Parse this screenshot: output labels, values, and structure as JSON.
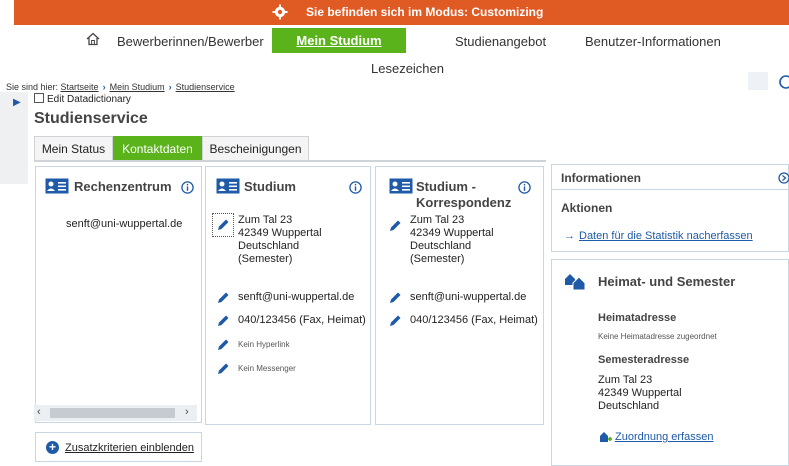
{
  "banner": {
    "text": "Sie befinden sich im Modus: Customizing",
    "icon": "gear-icon"
  },
  "topnav": {
    "items": [
      "Bewerberinnen/Bewerber",
      "Mein Studium",
      "Studienangebot",
      "Benutzer-Informationen"
    ],
    "active_index": 1,
    "bookmark": "Lesezeichen"
  },
  "breadcrumb": {
    "prefix": "Sie sind hier:",
    "items": [
      "Startseite",
      "Mein Studium",
      "Studienservice"
    ]
  },
  "edit_dd": "Edit Datadictionary",
  "page_title": "Studienservice",
  "tabs": [
    "Mein Status",
    "Kontaktdaten",
    "Bescheinigungen"
  ],
  "active_tab": 1,
  "cards": {
    "rechenzentrum": {
      "title": "Rechenzentrum",
      "email": "senft@uni-wuppertal.de"
    },
    "studium": {
      "title": "Studium",
      "address": [
        "Zum Tal 23",
        "42349 Wuppertal",
        "Deutschland",
        "(Semester)"
      ],
      "email": "senft@uni-wuppertal.de",
      "phone": "040/123456 (Fax, Heimat)",
      "hyperlink": "Kein Hyperlink",
      "messenger": "Kein Messenger"
    },
    "korrespondenz": {
      "title_line1": "Studium -",
      "title_line2": "Korrespondenz",
      "address": [
        "Zum Tal 23",
        "42349 Wuppertal",
        "Deutschland",
        "(Semester)"
      ],
      "email": "senft@uni-wuppertal.de",
      "phone": "040/123456 (Fax, Heimat)"
    }
  },
  "zusatz": "Zusatzkriterien einblenden",
  "right": {
    "informationen": "Informationen",
    "aktionen": "Aktionen",
    "aktion_link": "Daten für die Statistik nacherfassen",
    "heimat_title": "Heimat- und Semester",
    "heimatadresse_label": "Heimatadresse",
    "heimatadresse_none": "Keine Heimatadresse zugeordnet",
    "semesteradresse_label": "Semesteradresse",
    "semesteradresse": [
      "Zum Tal 23",
      "42349 Wuppertal",
      "Deutschland"
    ],
    "zuordnung": "Zuordnung erfassen"
  },
  "colors": {
    "accent": "#5ab31a",
    "banner": "#e05a24",
    "link": "#1e5aa8"
  }
}
